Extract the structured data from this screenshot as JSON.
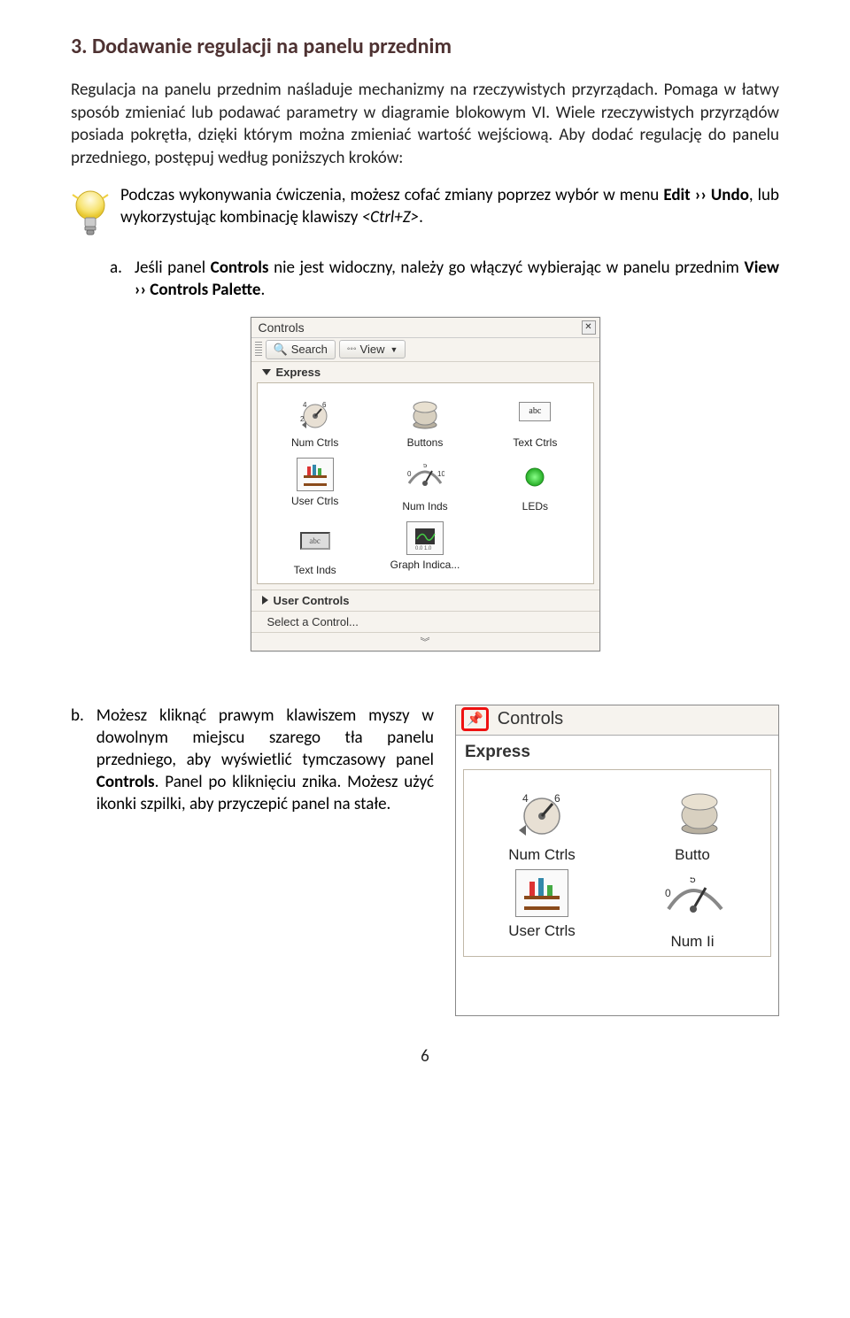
{
  "heading": "3. Dodawanie regulacji na panelu przednim",
  "para1": "Regulacja na panelu przednim naśladuje mechanizmy na rzeczywistych przyrządach. Pomaga w łatwy sposób zmieniać lub podawać parametry w diagramie blokowym VI. Wiele rzeczywistych przyrządów posiada pokrętła, dzięki którym można zmieniać wartość wejściową. Aby dodać regulację do panelu przedniego, postępuj według poniższych kroków:",
  "tip_pre": "Podczas wykonywania ćwiczenia, możesz cofać zmiany poprzez wybór w menu ",
  "tip_bold1": "Edit ›› Undo",
  "tip_mid": ", lub wykorzystując kombinację klawiszy ",
  "tip_ital": "<Ctrl+Z>",
  "tip_end": ".",
  "item_a_marker": "a.",
  "item_a_pre": "Jeśli panel ",
  "item_a_b1": "Controls",
  "item_a_mid": " nie jest widoczny, należy go włączyć wybierając w panelu przednim ",
  "item_a_b2": "View ›› Controls Palette",
  "item_a_end": ".",
  "palette": {
    "title": "Controls",
    "search": "Search",
    "view": "View",
    "section_open": "Express",
    "items": [
      "Num Ctrls",
      "Buttons",
      "Text Ctrls",
      "User Ctrls",
      "Num Inds",
      "LEDs",
      "Text Inds",
      "Graph Indica..."
    ],
    "section_closed": "User Controls",
    "select": "Select a Control..."
  },
  "item_b_marker": "b.",
  "item_b_pre": "Możesz kliknąć prawym klawiszem myszy w dowolnym miejscu szarego tła panelu przedniego, aby wyświetlić tymczasowy panel ",
  "item_b_b1": "Controls",
  "item_b_mid": ". Panel po kliknięciu znika. Możesz użyć ikonki szpilki, aby przyczepić panel na stałe.",
  "palette2": {
    "title": "Controls",
    "section": "Express",
    "items": [
      "Num Ctrls",
      "Butto",
      "User Ctrls",
      "Num Ii"
    ]
  },
  "page_number": "6"
}
